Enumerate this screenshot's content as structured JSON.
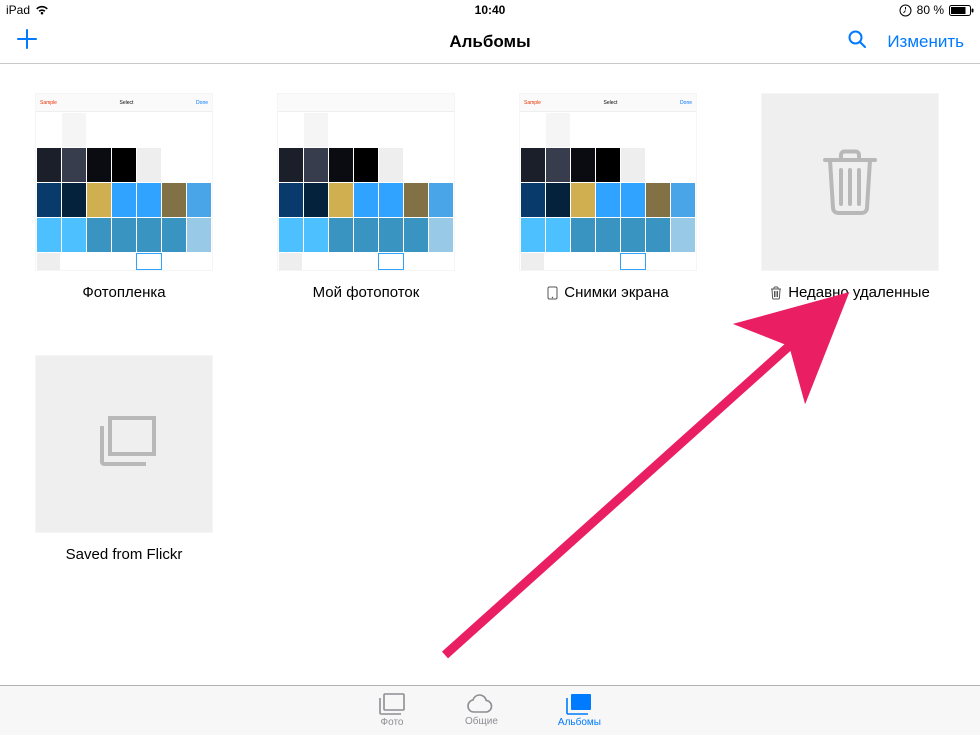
{
  "status": {
    "carrier": "iPad",
    "time": "10:40",
    "battery_pct": "80 %"
  },
  "nav": {
    "title": "Альбомы",
    "edit": "Изменить"
  },
  "albums": [
    {
      "label": "Фотопленка",
      "thumb": "grid",
      "icon": null
    },
    {
      "label": "Мой фотопоток",
      "thumb": "grid",
      "icon": null
    },
    {
      "label": "Снимки экрана",
      "thumb": "grid",
      "icon": "device"
    },
    {
      "label": "Недавно удаленные",
      "thumb": "trash",
      "icon": "trash"
    },
    {
      "label": "Saved from Flickr",
      "thumb": "stack",
      "icon": null
    }
  ],
  "tabs": {
    "photos": "Фото",
    "shared": "Общие",
    "albums": "Альбомы"
  }
}
